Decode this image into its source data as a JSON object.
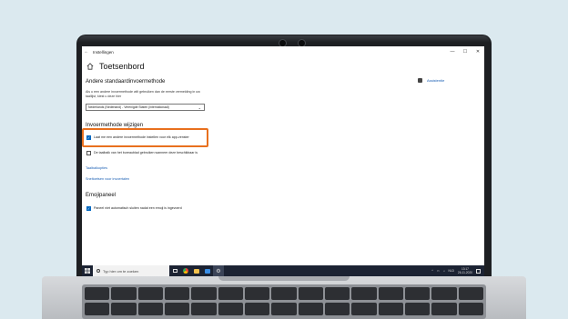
{
  "window": {
    "app_title": "Instellingen",
    "back_glyph": "←",
    "controls": [
      "—",
      "☐",
      "✕"
    ]
  },
  "header": {
    "title": "Toetsenbord",
    "icon": "home-icon"
  },
  "help": {
    "label": "Assistentie",
    "icon": "help-icon"
  },
  "section_default": {
    "title": "Andere standaardinvoermethode",
    "description": "Als u een andere invoermethode wilt gebruiken dan de eerste vermelding in uw taallijst, kiest u deze hier",
    "dropdown_value": "Nederlands (Nederland) - Verenigde Staten (internationaal)"
  },
  "section_switch": {
    "title": "Invoermethode wijzigen",
    "checkbox1_label": "Laat me een andere invoermethode instellen voor elk app-venster",
    "checkbox1_checked": true,
    "checkbox2_label": "De taalbalk van het bureaublad gebruiken wanneer deze beschikbaar is",
    "checkbox2_checked": false,
    "link1": "Taalbalkopties",
    "link2": "Sneltoetsen voor invoertalen"
  },
  "section_emoji": {
    "title": "Emojipaneel",
    "checkbox_label": "Paneel niet automatisch sluiten nadat een emoji is ingevoerd",
    "checkbox_checked": true
  },
  "taskbar": {
    "search_placeholder": "Typ hier om te zoeken",
    "tray_lang": "NLD",
    "time": "13:17",
    "date": "26-11-2020"
  },
  "colors": {
    "highlight": "#e8701e",
    "accent": "#0067c0",
    "link": "#1a5fb4"
  }
}
